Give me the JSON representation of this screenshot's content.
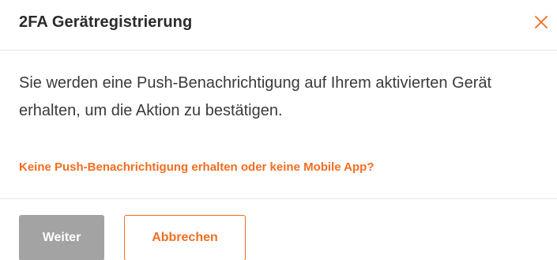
{
  "dialog": {
    "title": "2FA Gerätregistrierung",
    "close_icon": "close-icon",
    "message": "Sie werden eine Push-Benachrichtigung auf Ihrem aktivierten Gerät erhalten, um die Aktion zu bestätigen.",
    "help_link": "Keine Push-Benachrichtigung erhalten oder keine Mobile App?",
    "primary_button": "Weiter",
    "secondary_button": "Abbrechen"
  },
  "colors": {
    "accent": "#f26d21",
    "primary_button_disabled": "#a3a3a3",
    "divider": "#e3e3e3"
  }
}
